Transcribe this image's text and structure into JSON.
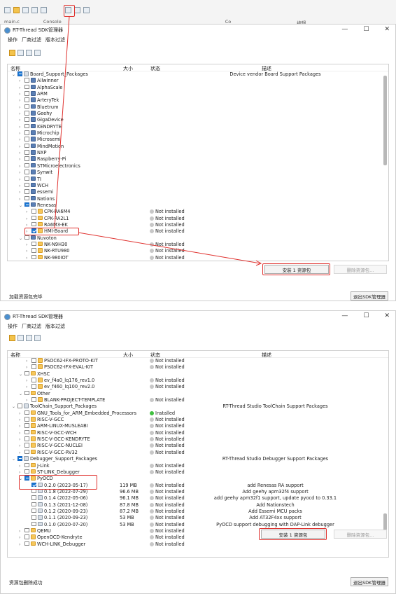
{
  "ide_strip": {
    "tabs": [
      "main.c",
      "Console",
      "Co",
      "编辑"
    ]
  },
  "window_title": "RT-Thread SDK管理器",
  "menu": [
    "操作",
    "厂商过滤",
    "版本过滤"
  ],
  "columns": {
    "name": "名称",
    "size": "大小",
    "status": "状态",
    "desc": "描述"
  },
  "top": {
    "rows": [
      {
        "d": 0,
        "chev": "⌄",
        "cb": "part",
        "ico": "pkg",
        "name": "Board_Support_Packages",
        "desc": "Device vendor Board Support Packages"
      },
      {
        "d": 1,
        "chev": "›",
        "cb": "",
        "ico": "logo",
        "name": "Allwinner"
      },
      {
        "d": 1,
        "chev": "›",
        "cb": "",
        "ico": "logo",
        "name": "AlphaScale"
      },
      {
        "d": 1,
        "chev": "›",
        "cb": "",
        "ico": "logo",
        "name": "ARM"
      },
      {
        "d": 1,
        "chev": "›",
        "cb": "",
        "ico": "logo",
        "name": "ArteryTek"
      },
      {
        "d": 1,
        "chev": "›",
        "cb": "",
        "ico": "logo",
        "name": "Bluetrum"
      },
      {
        "d": 1,
        "chev": "›",
        "cb": "",
        "ico": "logo",
        "name": "Geehy"
      },
      {
        "d": 1,
        "chev": "›",
        "cb": "",
        "ico": "logo",
        "name": "GigaDevice"
      },
      {
        "d": 1,
        "chev": "›",
        "cb": "",
        "ico": "logo",
        "name": "KENDRYTE"
      },
      {
        "d": 1,
        "chev": "›",
        "cb": "",
        "ico": "logo",
        "name": "Microchip"
      },
      {
        "d": 1,
        "chev": "›",
        "cb": "",
        "ico": "logo",
        "name": "Microsemi"
      },
      {
        "d": 1,
        "chev": "›",
        "cb": "",
        "ico": "logo",
        "name": "MindMotion"
      },
      {
        "d": 1,
        "chev": "›",
        "cb": "",
        "ico": "logo",
        "name": "NXP"
      },
      {
        "d": 1,
        "chev": "›",
        "cb": "",
        "ico": "logo",
        "name": "Raspberry-Pi"
      },
      {
        "d": 1,
        "chev": "›",
        "cb": "",
        "ico": "logo",
        "name": "STMicroelectronics"
      },
      {
        "d": 1,
        "chev": "›",
        "cb": "",
        "ico": "logo",
        "name": "Synwit"
      },
      {
        "d": 1,
        "chev": "›",
        "cb": "",
        "ico": "logo",
        "name": "TI"
      },
      {
        "d": 1,
        "chev": "›",
        "cb": "",
        "ico": "logo",
        "name": "WCH"
      },
      {
        "d": 1,
        "chev": "›",
        "cb": "",
        "ico": "logo",
        "name": "essemi"
      },
      {
        "d": 1,
        "chev": "›",
        "cb": "",
        "ico": "logo",
        "name": "Nations"
      },
      {
        "d": 1,
        "chev": "⌄",
        "cb": "part",
        "ico": "logo",
        "name": "Renesas"
      },
      {
        "d": 2,
        "chev": "›",
        "cb": "",
        "ico": "fold",
        "name": "CPK-RA6M4",
        "status": "Not installed"
      },
      {
        "d": 2,
        "chev": "›",
        "cb": "",
        "ico": "fold",
        "name": "CPK-RA2L1",
        "status": "Not installed"
      },
      {
        "d": 2,
        "chev": "›",
        "cb": "",
        "ico": "fold",
        "name": "RA6M3-EK",
        "status": "Not installed"
      },
      {
        "d": 2,
        "chev": "›",
        "cb": "on",
        "ico": "fold",
        "name": "HMI-Board",
        "status": "Not installed"
      },
      {
        "d": 1,
        "chev": "⌄",
        "cb": "",
        "ico": "logo",
        "name": "Nuvoton"
      },
      {
        "d": 2,
        "chev": "›",
        "cb": "",
        "ico": "fold",
        "name": "NK-N9H30",
        "status": "Not installed"
      },
      {
        "d": 2,
        "chev": "›",
        "cb": "",
        "ico": "fold",
        "name": "NK-RTU980",
        "status": "Not installed"
      },
      {
        "d": 2,
        "chev": "›",
        "cb": "",
        "ico": "fold",
        "name": "NK-980IOT",
        "status": "Not installed"
      }
    ],
    "install_btn": "安装 1 资源包",
    "remove_btn": "删除资源包...",
    "status_text": "加载资源包完毕",
    "exit_btn": "退出SDK管理器"
  },
  "bottom": {
    "rows": [
      {
        "d": 2,
        "chev": "›",
        "cb": "",
        "ico": "fold",
        "name": "PSOC62-IFX-PROTO-KIT",
        "status": "Not installed"
      },
      {
        "d": 2,
        "chev": "›",
        "cb": "",
        "ico": "fold",
        "name": "PSOC62-IFX-EVAL-KIT",
        "status": "Not installed"
      },
      {
        "d": 1,
        "chev": "⌄",
        "cb": "",
        "ico": "fold",
        "name": "XHSC"
      },
      {
        "d": 2,
        "chev": "›",
        "cb": "",
        "ico": "fold",
        "name": "ev_f4a0_lq176_rev1.0",
        "status": "Not installed"
      },
      {
        "d": 2,
        "chev": "›",
        "cb": "",
        "ico": "fold",
        "name": "ev_f460_lq100_rev2.0",
        "status": "Not installed"
      },
      {
        "d": 1,
        "chev": "⌄",
        "cb": "",
        "ico": "fold",
        "name": "Other"
      },
      {
        "d": 2,
        "chev": "›",
        "cb": "",
        "ico": "fold",
        "name": "BLANK-PROJECT-TEMPLATE",
        "status": "Not installed"
      },
      {
        "d": 0,
        "chev": "⌄",
        "cb": "",
        "ico": "pkg",
        "name": "ToolChain_Support_Packages",
        "desc": "RT-Thread Studio ToolChain Support Packages"
      },
      {
        "d": 1,
        "chev": "›",
        "cb": "",
        "ico": "fold",
        "name": "GNU_Tools_for_ARM_Embedded_Processors",
        "status": "Installed",
        "green": true
      },
      {
        "d": 1,
        "chev": "›",
        "cb": "",
        "ico": "fold",
        "name": "RISC-V-GCC",
        "status": "Not installed"
      },
      {
        "d": 1,
        "chev": "›",
        "cb": "",
        "ico": "fold",
        "name": "ARM-LINUX-MUSLEABI",
        "status": "Not installed"
      },
      {
        "d": 1,
        "chev": "›",
        "cb": "",
        "ico": "fold",
        "name": "RISC-V-GCC-WCH",
        "status": "Not installed"
      },
      {
        "d": 1,
        "chev": "›",
        "cb": "",
        "ico": "fold",
        "name": "RISC-V-GCC-KENDRYTE",
        "status": "Not installed"
      },
      {
        "d": 1,
        "chev": "›",
        "cb": "",
        "ico": "fold",
        "name": "RISC-V-GCC-NUCLEI",
        "status": "Not installed"
      },
      {
        "d": 1,
        "chev": "›",
        "cb": "",
        "ico": "fold",
        "name": "RISC-V-GCC-RV32",
        "status": "Not installed"
      },
      {
        "d": 0,
        "chev": "⌄",
        "cb": "part",
        "ico": "pkg",
        "name": "Debugger_Support_Packages",
        "desc": "RT-Thread Studio Debugger Support Packages"
      },
      {
        "d": 1,
        "chev": "›",
        "cb": "",
        "ico": "fold",
        "name": "J-Link",
        "status": "Not installed"
      },
      {
        "d": 1,
        "chev": "›",
        "cb": "",
        "ico": "fold",
        "name": "ST-LINK_Debugger",
        "status": "Not installed"
      },
      {
        "d": 1,
        "chev": "⌄",
        "cb": "part",
        "ico": "fold",
        "name": "PyOCD"
      },
      {
        "d": 2,
        "chev": "",
        "cb": "on",
        "ico": "pkg",
        "name": "0.2.0 (2023-05-17)",
        "size": "119 MB",
        "status": "Not installed",
        "desc": "add Renesas RA support"
      },
      {
        "d": 2,
        "chev": "",
        "cb": "",
        "ico": "pkg",
        "name": "0.1.8 (2022-07-29)",
        "size": "96.6 MB",
        "status": "Not installed",
        "desc": "Add geehy apm32f4 support"
      },
      {
        "d": 2,
        "chev": "",
        "cb": "",
        "ico": "pkg",
        "name": "0.1.4 (2022-05-06)",
        "size": "96.1 MB",
        "status": "Not installed",
        "desc": "add geehy apm32f1 support, update pyocd to 0.33.1"
      },
      {
        "d": 2,
        "chev": "",
        "cb": "",
        "ico": "pkg",
        "name": "0.1.3 (2021-12-08)",
        "size": "87.8 MB",
        "status": "Not installed",
        "desc": "Add Nationstech"
      },
      {
        "d": 2,
        "chev": "",
        "cb": "",
        "ico": "pkg",
        "name": "0.1.2 (2020-09-23)",
        "size": "87.2 MB",
        "status": "Not installed",
        "desc": "Add Essemi MCU packs"
      },
      {
        "d": 2,
        "chev": "",
        "cb": "",
        "ico": "pkg",
        "name": "0.1.1 (2020-09-23)",
        "size": "53 MB",
        "status": "Not installed",
        "desc": "Add AT32F4xx support"
      },
      {
        "d": 2,
        "chev": "",
        "cb": "",
        "ico": "pkg",
        "name": "0.1.0 (2020-07-20)",
        "size": "53 MB",
        "status": "Not installed",
        "desc": "PyOCD support debugging with DAP-Link debugger"
      },
      {
        "d": 1,
        "chev": "›",
        "cb": "",
        "ico": "fold",
        "name": "QEMU",
        "status": "Not installed"
      },
      {
        "d": 1,
        "chev": "›",
        "cb": "",
        "ico": "fold",
        "name": "OpenOCD-Kendryte",
        "status": "Not installed"
      },
      {
        "d": 1,
        "chev": "›",
        "cb": "",
        "ico": "fold",
        "name": "WCH-LINK_Debugger",
        "status": "Not installed"
      }
    ],
    "install_btn": "安装 1 资源包",
    "remove_btn": "删除资源包...",
    "status_text": "资源包删除成功",
    "exit_btn": "退出SDK管理器"
  },
  "colors": {
    "highlight": "#e0322f",
    "check": "#1976d2",
    "installed": "#3fbf3f"
  }
}
